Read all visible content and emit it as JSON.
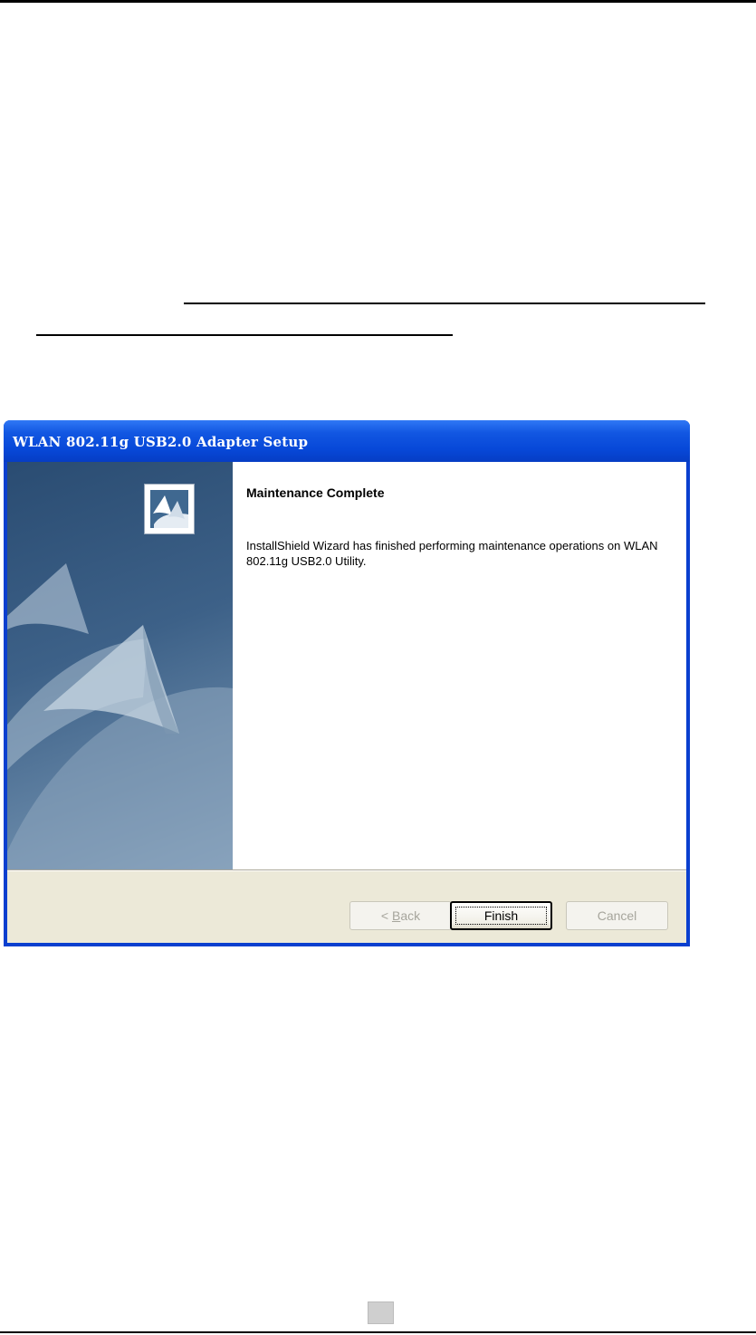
{
  "window": {
    "title": "WLAN 802.11g USB2.0 Adapter Setup",
    "heading": "Maintenance Complete",
    "message": "InstallShield Wizard has finished performing maintenance operations on WLAN 802.11g USB2.0 Utility.",
    "buttons": {
      "back_prefix": "< ",
      "back_mnemonic": "B",
      "back_rest": "ack",
      "finish": "Finish",
      "cancel": "Cancel"
    }
  }
}
